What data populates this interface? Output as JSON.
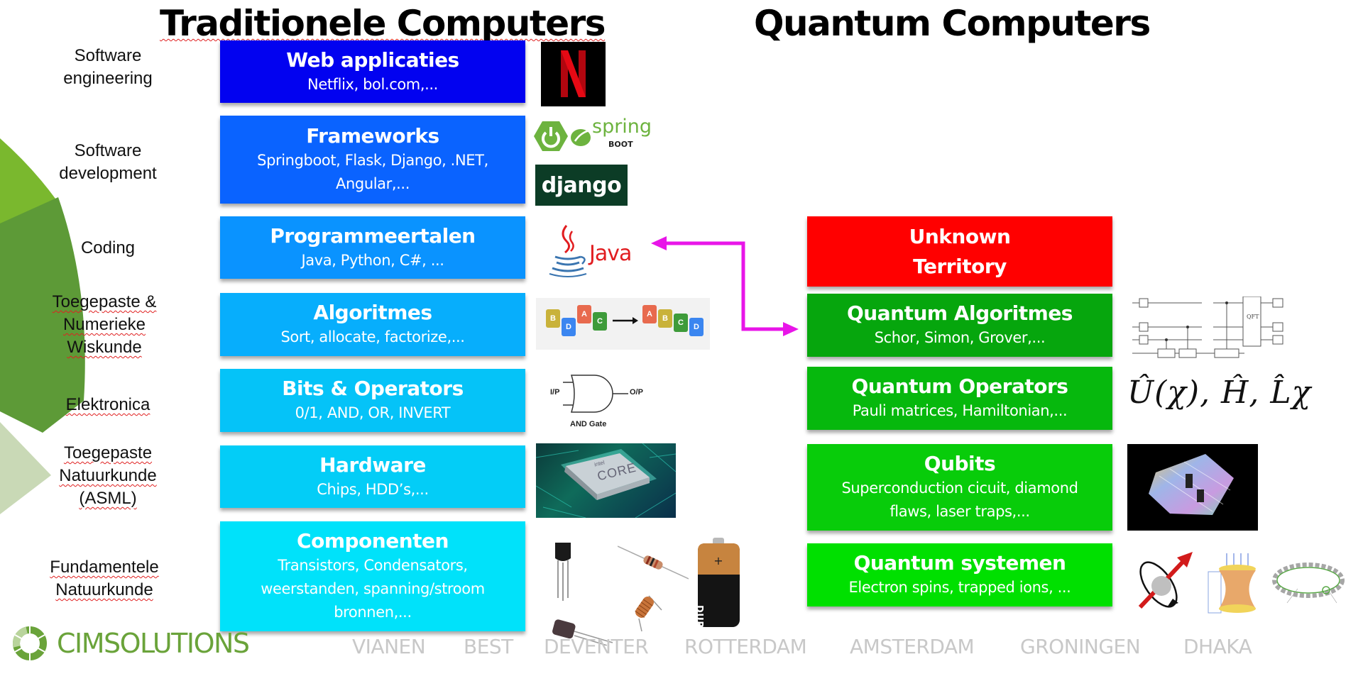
{
  "titles": {
    "traditional": "Traditionele Computers",
    "quantum": "Quantum Computers"
  },
  "side_labels": [
    {
      "text": "Software engineering"
    },
    {
      "text": "Software development"
    },
    {
      "text": "Coding"
    },
    {
      "text": "Toegepaste & Numerieke Wiskunde"
    },
    {
      "text": "Elektronica"
    },
    {
      "text": "Toegepaste Natuurkunde (ASML)"
    },
    {
      "text": "Fundamentele Natuurkunde"
    }
  ],
  "traditional_layers": [
    {
      "title": "Web applicaties",
      "subtitle": "Netflix, bol.com,...",
      "color": "#0202f0"
    },
    {
      "title": "Frameworks",
      "subtitle": "Springboot, Flask, Django, .NET, Angular,...",
      "color": "#0a63ff"
    },
    {
      "title": "Programmeertalen",
      "subtitle": "Java, Python, C#, ...",
      "color": "#0a93ff"
    },
    {
      "title": "Algoritmes",
      "subtitle": "Sort, allocate, factorize,...",
      "color": "#07aefc"
    },
    {
      "title": "Bits & Operators",
      "subtitle": "0/1, AND, OR, INVERT",
      "color": "#05c3f8"
    },
    {
      "title": "Hardware",
      "subtitle": "Chips, HDD’s,...",
      "color": "#03cdf7"
    },
    {
      "title": "Componenten",
      "subtitle": "Transistors, Condensators, weerstanden, spanning/stroom bronnen,...",
      "color": "#00e2fa"
    }
  ],
  "quantum_layers": [
    {
      "title": "Unknown Territory",
      "subtitle": "",
      "color": "#ff0000"
    },
    {
      "title": "Quantum Algoritmes",
      "subtitle": "Schor, Simon, Grover,...",
      "color": "#06a60d"
    },
    {
      "title": "Quantum Operators",
      "subtitle": "Pauli matrices, Hamiltonian,...",
      "color": "#06b80d"
    },
    {
      "title": "Qubits",
      "subtitle": "Superconduction cicuit, diamond flaws, laser traps,...",
      "color": "#08cc0a"
    },
    {
      "title": "Quantum systemen",
      "subtitle": "Electron spins, trapped ions, ...",
      "color": "#00e000"
    }
  ],
  "images": {
    "netflix": "N",
    "spring_word": "spring",
    "spring_boot": "BOOT",
    "django": "django",
    "java": "Java",
    "sort_before": [
      "B",
      "D",
      "A",
      "C"
    ],
    "sort_after": [
      "A",
      "B",
      "C",
      "D"
    ],
    "and_gate_in": "I/P",
    "and_gate_out": "O/P",
    "and_gate_caption": "AND Gate",
    "cpu_brand": "intel",
    "cpu_model": "CORE",
    "battery": "DURACELL",
    "qft_label": "QFT",
    "operator_formula": "Û(χ), Ĥ, L̂χ"
  },
  "arrow": {
    "color": "#e815e8",
    "meaning": "bidirectional link between Programmeertalen and Quantum Algoritmes"
  },
  "footer": {
    "brand": "CIMSOLUTIONS",
    "brand_color": "#6aa33a",
    "cities": [
      "VIANEN",
      "BEST",
      "DEVENTER",
      "ROTTERDAM",
      "AMSTERDAM",
      "GRONINGEN",
      "DHAKA"
    ]
  },
  "colors": {
    "pie_light": "#7ab82e",
    "pie_mid": "#5d9a37",
    "pie_pale": "#c9d9b6"
  }
}
